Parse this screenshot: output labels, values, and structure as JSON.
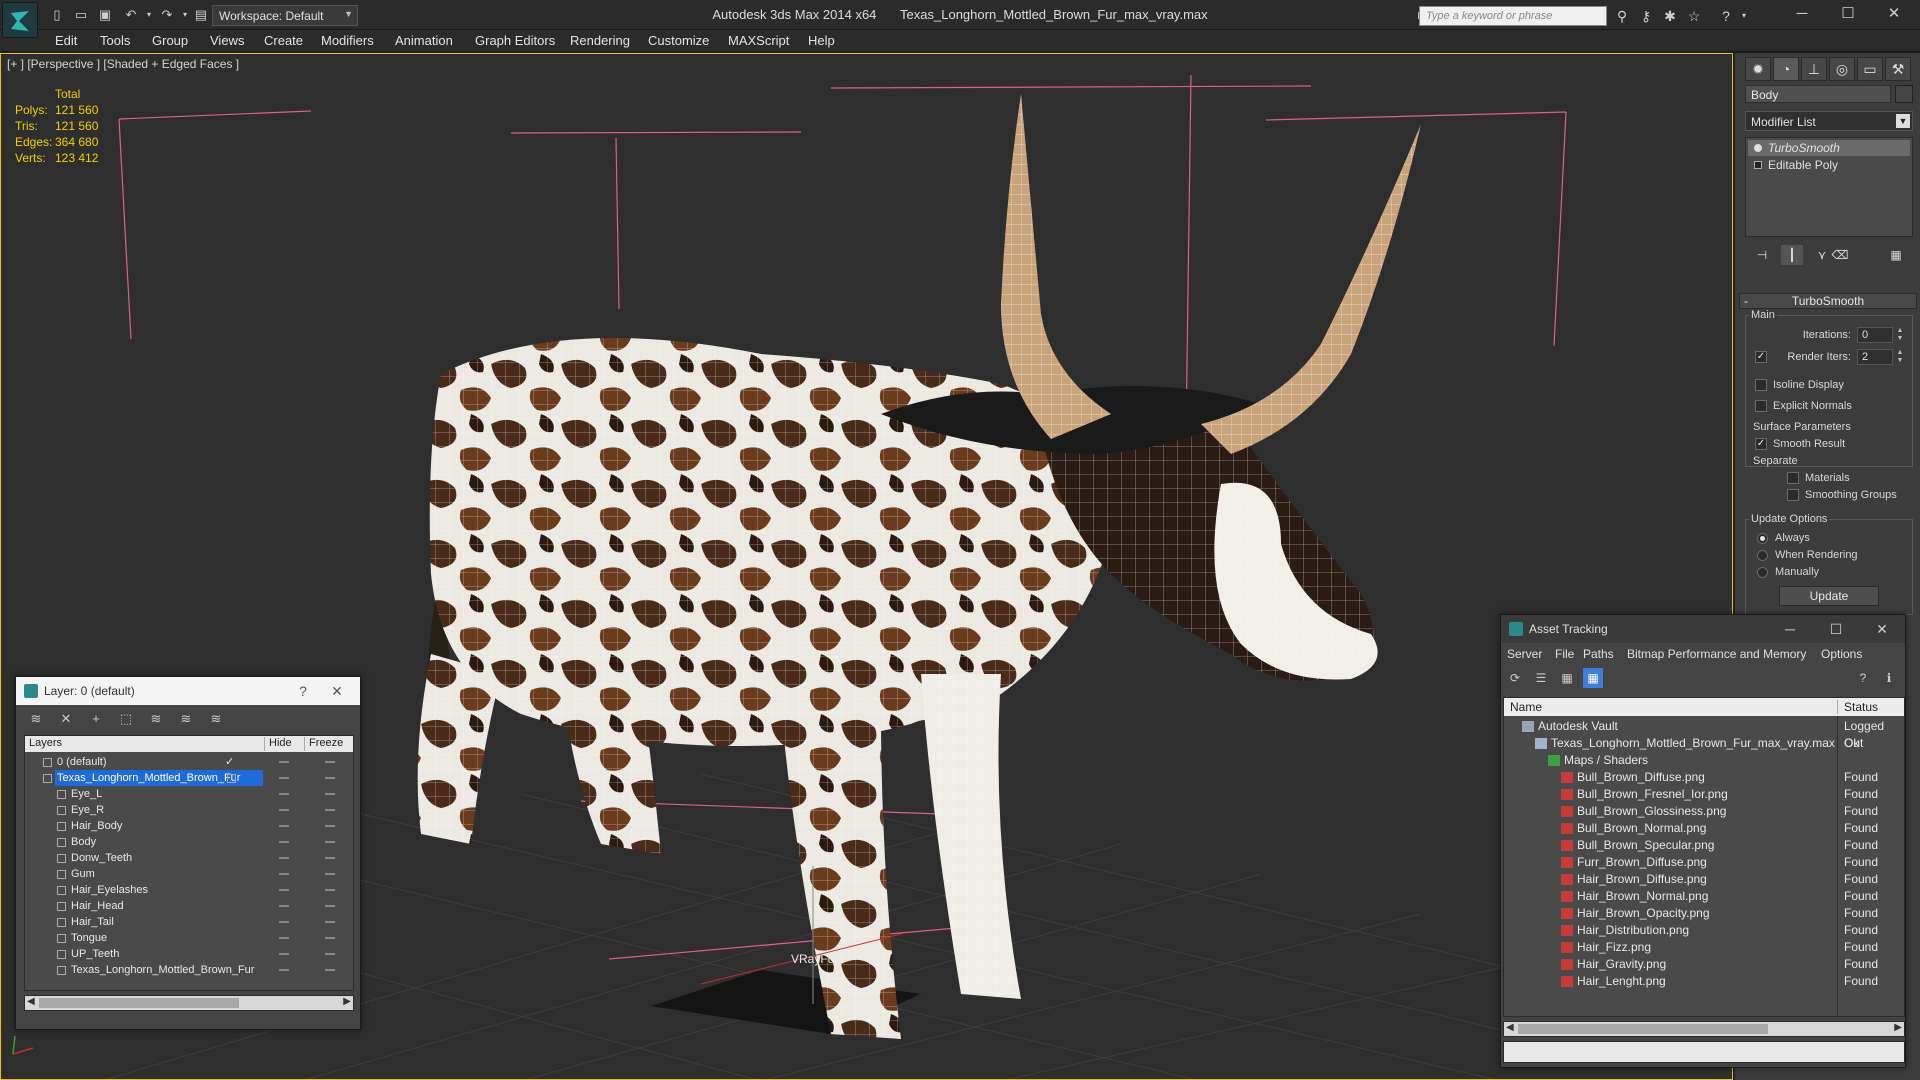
{
  "window": {
    "app_title": "Autodesk 3ds Max  2014 x64",
    "file_title": "Texas_Longhorn_Mottled_Brown_Fur_max_vray.max",
    "workspace": "Workspace: Default",
    "search_placeholder": "Type a keyword or phrase"
  },
  "menu": [
    "Edit",
    "Tools",
    "Group",
    "Views",
    "Create",
    "Modifiers",
    "Animation",
    "Graph Editors",
    "Rendering",
    "Customize",
    "MAXScript",
    "Help"
  ],
  "viewport": {
    "label": "[+ ] [Perspective ] [Shaded + Edged Faces ]",
    "stats": {
      "header": "Total",
      "rows": [
        {
          "key": "Polys:",
          "value": "121 560"
        },
        {
          "key": "Tris:",
          "value": "121 560"
        },
        {
          "key": "Edges:",
          "value": "364 680"
        },
        {
          "key": "Verts:",
          "value": "123 412"
        }
      ]
    },
    "helper_label": "VRayFur",
    "accent": "#f0c000"
  },
  "command_panel": {
    "object_name": "Body",
    "modifier_list": "Modifier List",
    "stack": [
      "TurboSmooth",
      "Editable Poly"
    ],
    "rollout": "TurboSmooth",
    "main": {
      "title": "Main",
      "iterations_label": "Iterations:",
      "iterations": "0",
      "render_iters_label": "Render Iters:",
      "render_iters": "2",
      "isoline": "Isoline Display",
      "explicit_normals": "Explicit Normals"
    },
    "surface": {
      "title": "Surface Parameters",
      "smooth_result": "Smooth Result",
      "separate": "Separate",
      "materials": "Materials",
      "smoothing_groups": "Smoothing Groups"
    },
    "update": {
      "title": "Update Options",
      "always": "Always",
      "when_rendering": "When Rendering",
      "manually": "Manually",
      "button": "Update"
    }
  },
  "layer_window": {
    "title": "Layer: 0 (default)",
    "help": "?",
    "columns": [
      "Layers",
      "Hide",
      "Freeze"
    ],
    "rows": [
      {
        "name": "0 (default)",
        "level": 0,
        "checked": true,
        "selected": false
      },
      {
        "name": "Texas_Longhorn_Mottled_Brown_Fur",
        "level": 0,
        "checked": false,
        "selected": true
      },
      {
        "name": "Eye_L",
        "level": 1
      },
      {
        "name": "Eye_R",
        "level": 1
      },
      {
        "name": "Hair_Body",
        "level": 1
      },
      {
        "name": "Body",
        "level": 1
      },
      {
        "name": "Donw_Teeth",
        "level": 1
      },
      {
        "name": "Gum",
        "level": 1
      },
      {
        "name": "Hair_Eyelashes",
        "level": 1
      },
      {
        "name": "Hair_Head",
        "level": 1
      },
      {
        "name": "Hair_Tail",
        "level": 1
      },
      {
        "name": "Tongue",
        "level": 1
      },
      {
        "name": "UP_Teeth",
        "level": 1
      },
      {
        "name": "Texas_Longhorn_Mottled_Brown_Fur",
        "level": 1
      }
    ]
  },
  "asset_window": {
    "title": "Asset Tracking",
    "menu": [
      "Server",
      "File",
      "Paths",
      "Bitmap Performance and Memory",
      "Options"
    ],
    "columns": [
      "Name",
      "Status"
    ],
    "rows": [
      {
        "name": "Autodesk Vault",
        "status": "Logged Out",
        "level": 0,
        "kind": "vault"
      },
      {
        "name": "Texas_Longhorn_Mottled_Brown_Fur_max_vray.max",
        "status": "Ok",
        "level": 1,
        "kind": "file"
      },
      {
        "name": "Maps / Shaders",
        "status": "",
        "level": 2,
        "kind": "maps"
      },
      {
        "name": "Bull_Brown_Diffuse.png",
        "status": "Found",
        "level": 3,
        "kind": "png"
      },
      {
        "name": "Bull_Brown_Fresnel_Ior.png",
        "status": "Found",
        "level": 3,
        "kind": "png"
      },
      {
        "name": "Bull_Brown_Glossiness.png",
        "status": "Found",
        "level": 3,
        "kind": "png"
      },
      {
        "name": "Bull_Brown_Normal.png",
        "status": "Found",
        "level": 3,
        "kind": "png"
      },
      {
        "name": "Bull_Brown_Specular.png",
        "status": "Found",
        "level": 3,
        "kind": "png"
      },
      {
        "name": "Furr_Brown_Diffuse.png",
        "status": "Found",
        "level": 3,
        "kind": "png"
      },
      {
        "name": "Hair_Brown_Diffuse.png",
        "status": "Found",
        "level": 3,
        "kind": "png"
      },
      {
        "name": "Hair_Brown_Normal.png",
        "status": "Found",
        "level": 3,
        "kind": "png"
      },
      {
        "name": "Hair_Brown_Opacity.png",
        "status": "Found",
        "level": 3,
        "kind": "png"
      },
      {
        "name": "Hair_Distribution.png",
        "status": "Found",
        "level": 3,
        "kind": "png"
      },
      {
        "name": "Hair_Fizz.png",
        "status": "Found",
        "level": 3,
        "kind": "png"
      },
      {
        "name": "Hair_Gravity.png",
        "status": "Found",
        "level": 3,
        "kind": "png"
      },
      {
        "name": "Hair_Lenght.png",
        "status": "Found",
        "level": 3,
        "kind": "png"
      }
    ]
  }
}
